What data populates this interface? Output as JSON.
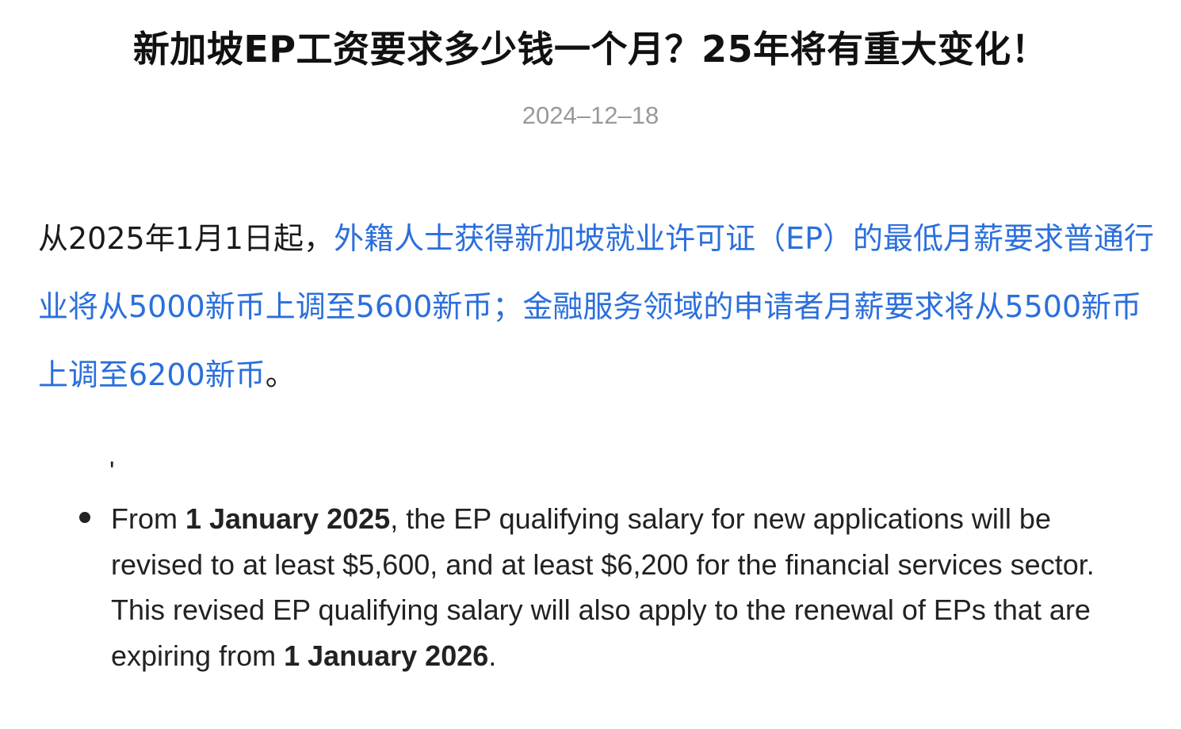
{
  "article": {
    "title": "新加坡EP工资要求多少钱一个月？25年将有重大变化！",
    "date": "2024–12–18"
  },
  "intro": {
    "lead": "从2025年1月1日起，",
    "highlight": "外籍人士获得新加坡就业许可证（EP）的最低月薪要求普通行业将从5000新币上调至5600新币；金融服务领域的申请者月薪要求将从5500新币上调至6200新币",
    "tail": "。"
  },
  "quote": {
    "stray_mark": "'",
    "bullet": {
      "p1_prefix": "From ",
      "p1_bold": "1 January 2025",
      "p1_rest": ", the EP qualifying salary for new applications will be revised to at least $5,600, and at least $6,200 for the financial services sector.",
      "p2_prefix": "This revised EP qualifying salary will also apply to the renewal of EPs that are expiring from ",
      "p2_bold": "1 January 2026",
      "p2_tail": "."
    }
  },
  "colors": {
    "highlight": "#2b6fdc",
    "date": "#999999",
    "text": "#1a1a1a"
  }
}
